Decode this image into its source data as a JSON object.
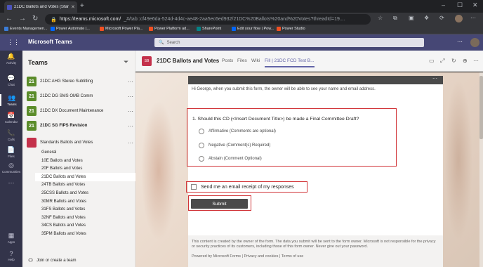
{
  "browser": {
    "tab_title": "21DC Ballots and Votes (Standard",
    "url_host": "https://teams.microsoft.com/",
    "url_path": "_#/tab::cf49e6da-524d-4d4c-ae48-2aa5ec6ed932/21DC%20Ballots%20and%20Votes?threadId=19....",
    "bookmarks": [
      {
        "label": "Events Managemen...",
        "icon": "calendar-icon",
        "color": "#3b7dd8"
      },
      {
        "label": "Power Automate |...",
        "icon": "power-automate-icon",
        "color": "#0066ff"
      },
      {
        "label": "Microsoft Power Pla...",
        "icon": "microsoft-icon",
        "color": "#f25022"
      },
      {
        "label": "Power Platform ad...",
        "icon": "microsoft-icon",
        "color": "#f25022"
      },
      {
        "label": "SharePoint",
        "icon": "sharepoint-icon",
        "color": "#038387"
      },
      {
        "label": "Edit your flow | Pow...",
        "icon": "power-automate-icon",
        "color": "#0066ff"
      },
      {
        "label": "Power Studio",
        "icon": "microsoft-icon",
        "color": "#f25022"
      }
    ]
  },
  "teams": {
    "brand": "Microsoft Teams",
    "search_placeholder": "Search",
    "rail": [
      {
        "label": "Activity",
        "icon": "bell-icon"
      },
      {
        "label": "Chat",
        "icon": "chat-icon"
      },
      {
        "label": "Teams",
        "icon": "teams-icon"
      },
      {
        "label": "Calendar",
        "icon": "calendar-icon"
      },
      {
        "label": "Calls",
        "icon": "phone-icon"
      },
      {
        "label": "Files",
        "icon": "file-icon"
      },
      {
        "label": "Communities",
        "icon": "communities-icon"
      },
      {
        "label": "...",
        "icon": "more-icon"
      },
      {
        "label": "Apps",
        "icon": "apps-icon"
      },
      {
        "label": "Help",
        "icon": "help-icon"
      }
    ],
    "sidebar_title": "Teams",
    "teams_list": [
      {
        "badge": "21",
        "name": "21DC AHG Stereo Subtitling",
        "color": "#5b8c2a",
        "bold": false
      },
      {
        "badge": "21",
        "name": "21DC DG SMS OMB Comm",
        "color": "#5b8c2a",
        "bold": false
      },
      {
        "badge": "21",
        "name": "21DC DX Document Maintenance",
        "color": "#5b8c2a",
        "bold": false
      },
      {
        "badge": "21",
        "name": "21DC SG FIPS Revision",
        "color": "#5b8c2a",
        "bold": true
      },
      {
        "badge": "",
        "name": "Standards Ballots and Votes",
        "color": "#c4314b",
        "bold": false
      }
    ],
    "channels": [
      "General",
      "10E Ballots and Votes",
      "20F Ballots and Votes",
      "21DC Ballots and Votes",
      "24TB Ballots and Votes",
      "25CSS Ballots and Votes",
      "30MR Ballots and Votes",
      "31FS Ballots and Votes",
      "32NF Ballots and Votes",
      "34CS Ballots and Votes",
      "35PM Ballots and Votes"
    ],
    "selected_channel_index": 3,
    "join_label": "Join or create a team"
  },
  "channel": {
    "name": "21DC Ballots and Votes",
    "tabs": [
      "Posts",
      "Files",
      "Wiki",
      "Fill | 21DC FCD Test B..."
    ],
    "active_tab_index": 3
  },
  "form": {
    "notice": "Hi George, when you submit this form, the owner will be able to see your name and email address.",
    "question": "1. Should this CD (<Insert Document Title>) be made a Final Committee Draft?",
    "options": [
      "Affirmative (Comments are optional)",
      "Negative (Comment(s) Required)",
      "Abstain (Comment Optional)"
    ],
    "receipt_label": "Send me an email receipt of my responses",
    "submit_label": "Submit",
    "footer_disclaimer": "This content is created by the owner of the form. The data you submit will be sent to the form owner. Microsoft is not responsible for the privacy or security practices of its customers, including those of this form owner. Never give out your password.",
    "footer_powered": "Powered by Microsoft Forms | Privacy and cookies | Terms of use"
  },
  "colors": {
    "teams_header": "#464775",
    "accent": "#6264a7",
    "highlight_box": "#d13438"
  }
}
